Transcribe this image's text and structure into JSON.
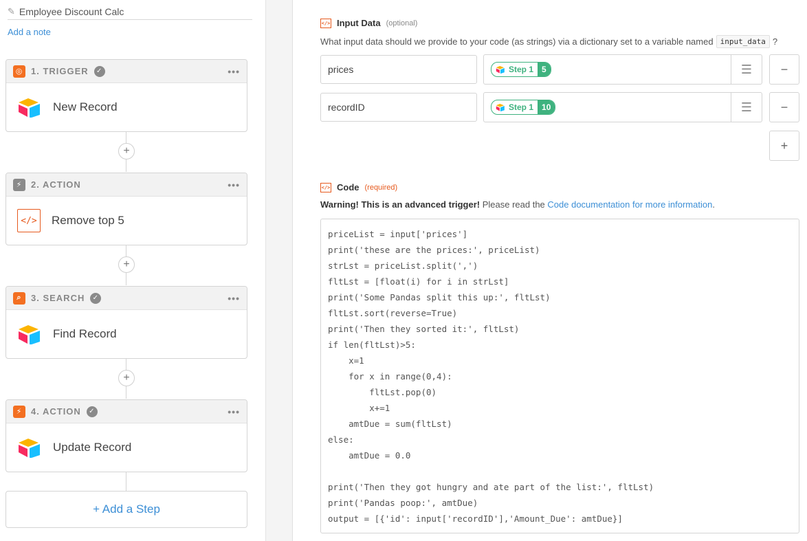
{
  "zap": {
    "title": "Employee Discount Calc",
    "add_note": "Add a note"
  },
  "steps": [
    {
      "header": "1. TRIGGER",
      "name": "New Record",
      "badge_color": "#f36f21",
      "app_icon": "airtable-icon"
    },
    {
      "header": "2. ACTION",
      "name": "Remove top 5",
      "badge_color": "#8a8a8a",
      "app_icon": "code-icon"
    },
    {
      "header": "3. SEARCH",
      "name": "Find Record",
      "badge_color": "#f36f21",
      "app_icon": "airtable-icon"
    },
    {
      "header": "4. ACTION",
      "name": "Update Record",
      "badge_color": "#f36f21",
      "app_icon": "airtable-icon"
    }
  ],
  "add_step_label": "+ Add a Step",
  "input_data": {
    "title": "Input Data",
    "optional": "(optional)",
    "description": "What input data should we provide to your code (as strings) via a dictionary set to a variable named",
    "var_name": "input_data",
    "help": "?",
    "rows": [
      {
        "key": "prices",
        "step_label": "Step 1",
        "field_num": "5"
      },
      {
        "key": "recordID",
        "step_label": "Step 1",
        "field_num": "10"
      }
    ]
  },
  "code_section": {
    "title": "Code",
    "required": "(required)",
    "warning_bold": "Warning! This is an advanced trigger!",
    "warning_text": " Please read the ",
    "warning_link": "Code documentation for more information",
    "warning_end": ".",
    "lines": [
      "priceList = input['prices']",
      "print('these are the prices:', priceList)",
      "strLst = priceList.split(',')",
      "fltLst = [float(i) for i in strLst]",
      "print('Some Pandas split this up:', fltLst)",
      "fltLst.sort(reverse=True)",
      "print('Then they sorted it:', fltLst)",
      "if len(fltLst)>5:",
      "    x=1",
      "    for x in range(0,4):",
      "        fltLst.pop(0)",
      "        x+=1",
      "    amtDue = sum(fltLst)",
      "else:",
      "    amtDue = 0.0",
      "",
      "print('Then they got hungry and ate part of the list:', fltLst)",
      "print('Pandas poop:', amtDue)",
      "output = [{'id': input['recordID'],'Amount_Due': amtDue}]"
    ]
  },
  "colors": {
    "accent_blue": "#3d8fd6",
    "zapier_orange": "#f36f21",
    "step_green": "#3fb27f"
  }
}
